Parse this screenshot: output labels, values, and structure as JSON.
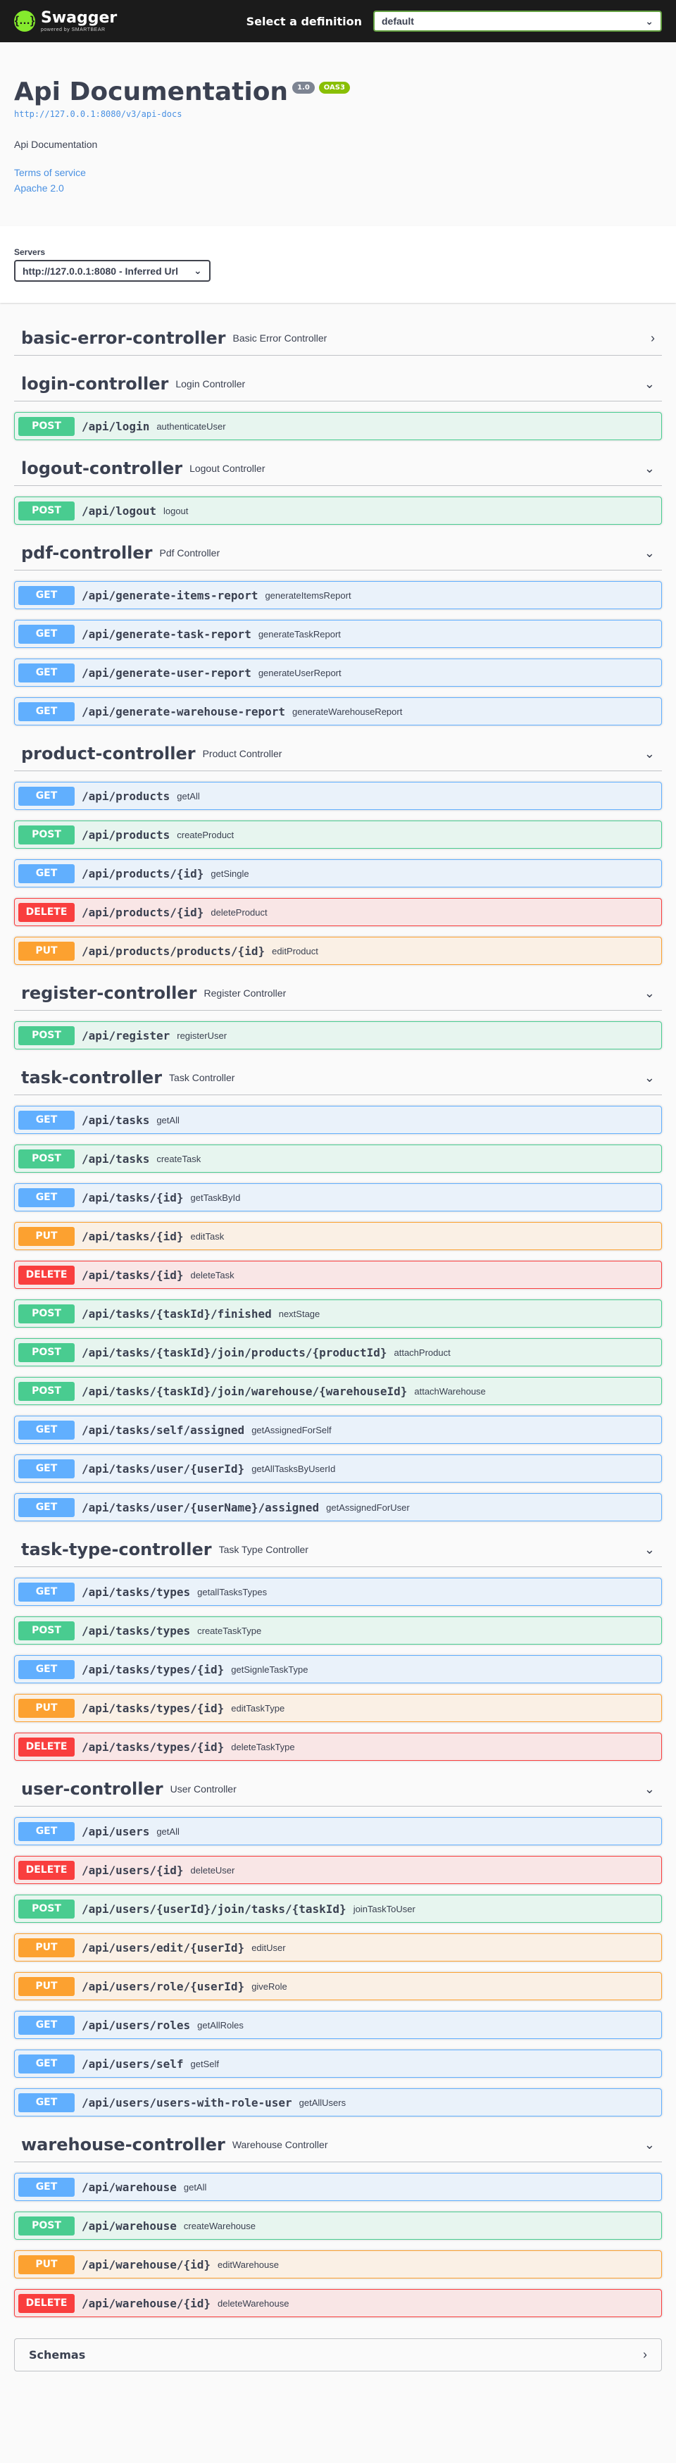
{
  "topbar": {
    "logo_title": "Swagger",
    "logo_sub": "powered by SMARTBEAR",
    "definition_label": "Select a definition",
    "definition_value": "default"
  },
  "info": {
    "title": "Api Documentation",
    "version": "1.0",
    "oas": "OAS3",
    "docs_url": "http://127.0.0.1:8080/v3/api-docs",
    "description": "Api Documentation",
    "terms_link": "Terms of service",
    "license_link": "Apache 2.0"
  },
  "servers": {
    "label": "Servers",
    "selected": "http://127.0.0.1:8080 - Inferred Url"
  },
  "tags": [
    {
      "name": "basic-error-controller",
      "desc": "Basic Error Controller",
      "collapsed": true,
      "ops": []
    },
    {
      "name": "login-controller",
      "desc": "Login Controller",
      "collapsed": false,
      "ops": [
        {
          "method": "POST",
          "cls": "post",
          "path": "/api/login",
          "summary": "authenticateUser"
        }
      ]
    },
    {
      "name": "logout-controller",
      "desc": "Logout Controller",
      "collapsed": false,
      "ops": [
        {
          "method": "POST",
          "cls": "post",
          "path": "/api/logout",
          "summary": "logout"
        }
      ]
    },
    {
      "name": "pdf-controller",
      "desc": "Pdf Controller",
      "collapsed": false,
      "ops": [
        {
          "method": "GET",
          "cls": "get",
          "path": "/api/generate-items-report",
          "summary": "generateItemsReport"
        },
        {
          "method": "GET",
          "cls": "get",
          "path": "/api/generate-task-report",
          "summary": "generateTaskReport"
        },
        {
          "method": "GET",
          "cls": "get",
          "path": "/api/generate-user-report",
          "summary": "generateUserReport"
        },
        {
          "method": "GET",
          "cls": "get",
          "path": "/api/generate-warehouse-report",
          "summary": "generateWarehouseReport"
        }
      ]
    },
    {
      "name": "product-controller",
      "desc": "Product Controller",
      "collapsed": false,
      "ops": [
        {
          "method": "GET",
          "cls": "get",
          "path": "/api/products",
          "summary": "getAll"
        },
        {
          "method": "POST",
          "cls": "post",
          "path": "/api/products",
          "summary": "createProduct"
        },
        {
          "method": "GET",
          "cls": "get",
          "path": "/api/products/{id}",
          "summary": "getSingle"
        },
        {
          "method": "DELETE",
          "cls": "delete",
          "path": "/api/products/{id}",
          "summary": "deleteProduct"
        },
        {
          "method": "PUT",
          "cls": "put",
          "path": "/api/products/products/{id}",
          "summary": "editProduct"
        }
      ]
    },
    {
      "name": "register-controller",
      "desc": "Register Controller",
      "collapsed": false,
      "ops": [
        {
          "method": "POST",
          "cls": "post",
          "path": "/api/register",
          "summary": "registerUser"
        }
      ]
    },
    {
      "name": "task-controller",
      "desc": "Task Controller",
      "collapsed": false,
      "ops": [
        {
          "method": "GET",
          "cls": "get",
          "path": "/api/tasks",
          "summary": "getAll"
        },
        {
          "method": "POST",
          "cls": "post",
          "path": "/api/tasks",
          "summary": "createTask"
        },
        {
          "method": "GET",
          "cls": "get",
          "path": "/api/tasks/{id}",
          "summary": "getTaskById"
        },
        {
          "method": "PUT",
          "cls": "put",
          "path": "/api/tasks/{id}",
          "summary": "editTask"
        },
        {
          "method": "DELETE",
          "cls": "delete",
          "path": "/api/tasks/{id}",
          "summary": "deleteTask"
        },
        {
          "method": "POST",
          "cls": "post",
          "path": "/api/tasks/{taskId}/finished",
          "summary": "nextStage"
        },
        {
          "method": "POST",
          "cls": "post",
          "path": "/api/tasks/{taskId}/join/products/{productId}",
          "summary": "attachProduct"
        },
        {
          "method": "POST",
          "cls": "post",
          "path": "/api/tasks/{taskId}/join/warehouse/{warehouseId}",
          "summary": "attachWarehouse"
        },
        {
          "method": "GET",
          "cls": "get",
          "path": "/api/tasks/self/assigned",
          "summary": "getAssignedForSelf"
        },
        {
          "method": "GET",
          "cls": "get",
          "path": "/api/tasks/user/{userId}",
          "summary": "getAllTasksByUserId"
        },
        {
          "method": "GET",
          "cls": "get",
          "path": "/api/tasks/user/{userName}/assigned",
          "summary": "getAssignedForUser"
        }
      ]
    },
    {
      "name": "task-type-controller",
      "desc": "Task Type Controller",
      "collapsed": false,
      "ops": [
        {
          "method": "GET",
          "cls": "get",
          "path": "/api/tasks/types",
          "summary": "getallTasksTypes"
        },
        {
          "method": "POST",
          "cls": "post",
          "path": "/api/tasks/types",
          "summary": "createTaskType"
        },
        {
          "method": "GET",
          "cls": "get",
          "path": "/api/tasks/types/{id}",
          "summary": "getSignleTaskType"
        },
        {
          "method": "PUT",
          "cls": "put",
          "path": "/api/tasks/types/{id}",
          "summary": "editTaskType"
        },
        {
          "method": "DELETE",
          "cls": "delete",
          "path": "/api/tasks/types/{id}",
          "summary": "deleteTaskType"
        }
      ]
    },
    {
      "name": "user-controller",
      "desc": "User Controller",
      "collapsed": false,
      "ops": [
        {
          "method": "GET",
          "cls": "get",
          "path": "/api/users",
          "summary": "getAll"
        },
        {
          "method": "DELETE",
          "cls": "delete",
          "path": "/api/users/{id}",
          "summary": "deleteUser"
        },
        {
          "method": "POST",
          "cls": "post",
          "path": "/api/users/{userId}/join/tasks/{taskId}",
          "summary": "joinTaskToUser"
        },
        {
          "method": "PUT",
          "cls": "put",
          "path": "/api/users/edit/{userId}",
          "summary": "editUser"
        },
        {
          "method": "PUT",
          "cls": "put",
          "path": "/api/users/role/{userId}",
          "summary": "giveRole"
        },
        {
          "method": "GET",
          "cls": "get",
          "path": "/api/users/roles",
          "summary": "getAllRoles"
        },
        {
          "method": "GET",
          "cls": "get",
          "path": "/api/users/self",
          "summary": "getSelf"
        },
        {
          "method": "GET",
          "cls": "get",
          "path": "/api/users/users-with-role-user",
          "summary": "getAllUsers"
        }
      ]
    },
    {
      "name": "warehouse-controller",
      "desc": "Warehouse Controller",
      "collapsed": false,
      "ops": [
        {
          "method": "GET",
          "cls": "get",
          "path": "/api/warehouse",
          "summary": "getAll"
        },
        {
          "method": "POST",
          "cls": "post",
          "path": "/api/warehouse",
          "summary": "createWarehouse"
        },
        {
          "method": "PUT",
          "cls": "put",
          "path": "/api/warehouse/{id}",
          "summary": "editWarehouse"
        },
        {
          "method": "DELETE",
          "cls": "delete",
          "path": "/api/warehouse/{id}",
          "summary": "deleteWarehouse"
        }
      ]
    }
  ],
  "schemas": {
    "title": "Schemas"
  },
  "colors": {
    "get": "#61affe",
    "post": "#49cc90",
    "put": "#fca130",
    "delete": "#f93e3e",
    "brand": "#85ea2d"
  }
}
